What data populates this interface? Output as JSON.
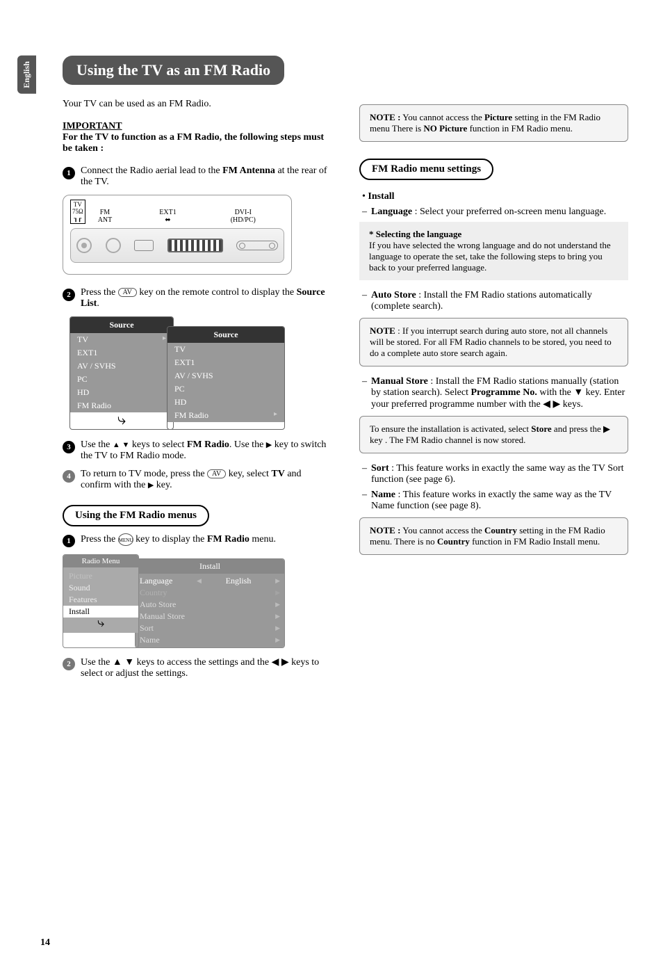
{
  "lang_tab": "English",
  "title": "Using the TV as an FM Radio",
  "intro": "Your TV can be used as an FM Radio.",
  "important_head": "IMPORTANT",
  "important_text": "For the TV to function as a FM Radio, the following steps must be taken :",
  "step1_a": "Connect the Radio aerial lead to the ",
  "step1_b": "FM Antenna",
  "step1_c": "  at the rear of the TV.",
  "rear": {
    "tv": "TV",
    "ohm": "75Ω",
    "fm": "FM",
    "ant": "ANT",
    "ext1": "EXT1",
    "dvi": "DVI-I",
    "hdpc": "(HD/PC)"
  },
  "step2_a": "Press the ",
  "step2_b": " key on the remote control to display the ",
  "step2_c": "Source List",
  "av_key": "AV",
  "menu_key": "MENU",
  "source_head": "Source",
  "source_items": [
    "TV",
    "EXT1",
    "AV / SVHS",
    "PC",
    "HD",
    "FM Radio"
  ],
  "step3_a": "Use the ",
  "step3_b": " keys to select ",
  "step3_c": "FM Radio",
  "step3_d": ". Use the ",
  "step3_e": " key to switch the TV to FM Radio mode.",
  "step4_a": "To return to TV mode, press the ",
  "step4_b": " key, select ",
  "step4_c": "TV",
  "step4_d": " and confirm with the  ",
  "step4_e": " key.",
  "fm_menus_head": "Using the FM Radio menus",
  "menus_step1_a": "Press the ",
  "menus_step1_b": " key to display the ",
  "menus_step1_c": "FM Radio",
  "menus_step1_d": " menu.",
  "radio_menu": {
    "head": "Radio Menu",
    "items": [
      "Picture",
      "Sound",
      "Features",
      "Install"
    ],
    "inst_head": "Install",
    "rows": [
      {
        "l": "Language",
        "v": "English",
        "on": true
      },
      {
        "l": "Country",
        "v": "",
        "on": false
      },
      {
        "l": "Auto Store",
        "v": "",
        "on": false
      },
      {
        "l": "Manual Store",
        "v": "",
        "on": false
      },
      {
        "l": "Sort",
        "v": "",
        "on": false
      },
      {
        "l": "Name",
        "v": "",
        "on": false
      }
    ]
  },
  "menus_step2": "Use the ▲ ▼ keys to access the settings and the ◀  ▶ keys to select or adjust the settings.",
  "note1_a": "NOTE :",
  "note1_b": " You cannot access the ",
  "note1_c": "Picture",
  "note1_d": " setting in the FM Radio menu There is ",
  "note1_e": "NO Picture",
  "note1_f": " function in FM Radio menu.",
  "settings_head": "FM Radio menu settings",
  "install_label": "Install",
  "lang_a": "Language",
  "lang_b": " : Select your preferred on-screen menu language.",
  "sel_lang_head": "* Selecting the language",
  "sel_lang_body": "If you have selected the wrong language and do not understand the language to operate the set, take the following steps to bring you back to your preferred language.",
  "auto_a": "Auto Store",
  "auto_b": " : Install the FM Radio stations automatically (complete search).",
  "note2_a": "NOTE",
  "note2_b": " : If you interrupt search during auto store, not all channels will be stored. For all FM Radio channels to be stored, you need to do a complete auto store search again.",
  "manual_a": "Manual Store",
  "manual_b": " : Install the FM Radio stations manually (station by station search). Select ",
  "manual_c": "Programme No.",
  "manual_d": " with the ▼ key. Enter your preferred programme number with the ◀  ▶ keys.",
  "store_box_a": "To ensure the installation is activated, select ",
  "store_box_b": "Store",
  "store_box_c": " and press the ▶ key . The FM Radio channel is now stored.",
  "sort_a": "Sort",
  "sort_b": " : This feature works in exactly the same way as the TV Sort function (see page 6).",
  "name_a": "Name",
  "name_b": " : This feature works in exactly the same way as the TV Name function (see page 8).",
  "note3_a": "NOTE :",
  "note3_b": " You cannot access the ",
  "note3_c": "Country",
  "note3_d": " setting in the FM Radio menu. There is no ",
  "note3_e": "Country",
  "note3_f": " function in FM Radio Install menu.",
  "page": "14"
}
